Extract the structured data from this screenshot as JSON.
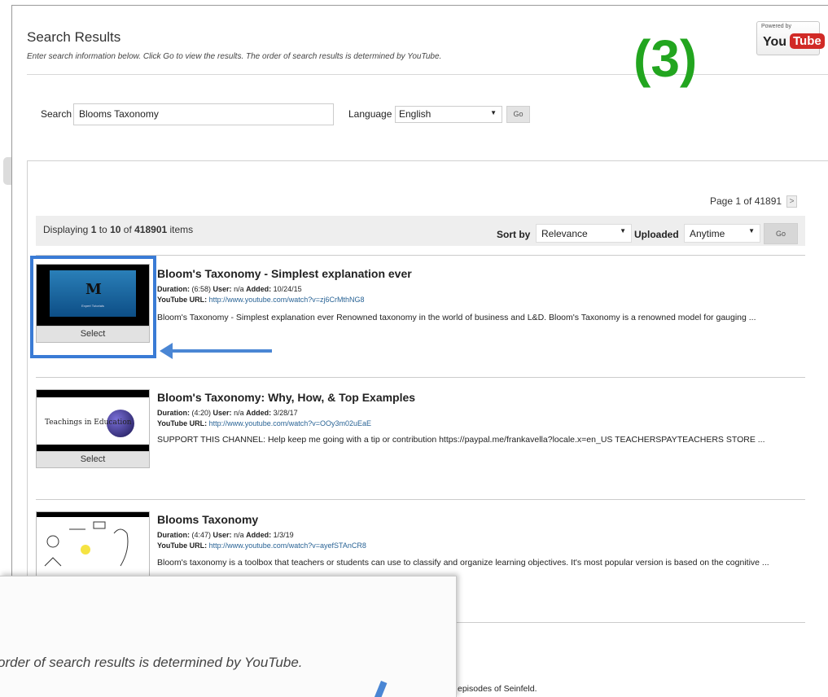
{
  "header": {
    "title": "Search Results",
    "subtitle": "Enter search information below. Click Go to view the results. The order of search results is determined by YouTube.",
    "marker": "(3)",
    "logo": {
      "powered_by": "Powered by",
      "you": "You",
      "tube": "Tube"
    }
  },
  "search": {
    "label": "Search",
    "value": "Blooms Taxonomy",
    "language_label": "Language",
    "language_value": "English",
    "go_label": "Go"
  },
  "pagination": {
    "text": "Page 1 of 41891",
    "next_symbol": ">"
  },
  "toolbar": {
    "display_prefix": "Displaying ",
    "display_from": "1",
    "display_to_word": " to ",
    "display_to": "10",
    "display_of_word": " of ",
    "display_total": "418901",
    "display_suffix": " items",
    "sort_label": "Sort by",
    "sort_value": "Relevance",
    "uploaded_label": "Uploaded",
    "uploaded_value": "Anytime",
    "go_label": "Go"
  },
  "labels": {
    "duration": "Duration:",
    "user": "User:",
    "added": "Added:",
    "url": "YouTube URL:",
    "select": "Select"
  },
  "results": [
    {
      "title": "Bloom's Taxonomy - Simplest explanation ever",
      "duration": "(6:58)",
      "user": "n/a",
      "added": "10/24/15",
      "url": "http://www.youtube.com/watch?v=zj6CrMthNG8",
      "description": "Bloom's Taxonomy - Simplest explanation ever Renowned taxonomy in the world of business and L&D. Bloom's Taxonomy is a renowned model for gauging ...",
      "thumb_caption": "Expert Tutorials"
    },
    {
      "title": "Bloom's Taxonomy: Why, How, & Top Examples",
      "duration": "(4:20)",
      "user": "n/a",
      "added": "3/28/17",
      "url": "http://www.youtube.com/watch?v=OOy3m02uEaE",
      "description": "SUPPORT THIS CHANNEL: Help keep me going with a tip or contribution https://paypal.me/frankavella?locale.x=en_US TEACHERSPAYTEACHERS STORE ...",
      "thumb_caption": "Teachings in Education"
    },
    {
      "title": "Blooms Taxonomy",
      "duration": "(4:47)",
      "user": "n/a",
      "added": "1/3/19",
      "url": "http://www.youtube.com/watch?v=ayefSTAnCR8",
      "description": "Bloom's taxonomy is a toolbox that teachers or students can use to classify and organize learning objectives. It's most popular version is based on the cognitive ..."
    },
    {
      "description": "episodes of Seinfeld."
    }
  ],
  "zoom": {
    "text": "order of search results is determined by YouTube."
  },
  "colors": {
    "highlight": "#3a7bd5",
    "marker": "#22a51f",
    "link": "#2a6496"
  }
}
